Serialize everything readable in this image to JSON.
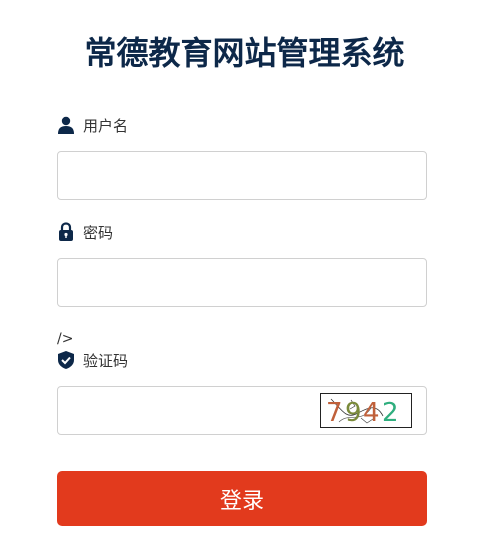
{
  "title": "常德教育网站管理系统",
  "username": {
    "label": "用户名",
    "value": "",
    "placeholder": ""
  },
  "password": {
    "label": "密码",
    "value": "",
    "placeholder": ""
  },
  "stray_text": "/>",
  "captcha": {
    "label": "验证码",
    "value": "",
    "placeholder": "",
    "image_text": [
      "7",
      "9",
      "4",
      "2"
    ],
    "digit_colors": [
      "#c0603a",
      "#7a8a3a",
      "#c0603a",
      "#2fae7e"
    ]
  },
  "login_button": "登录",
  "colors": {
    "title": "#0d2849",
    "icon": "#0d2849",
    "button": "#e23a1d"
  }
}
